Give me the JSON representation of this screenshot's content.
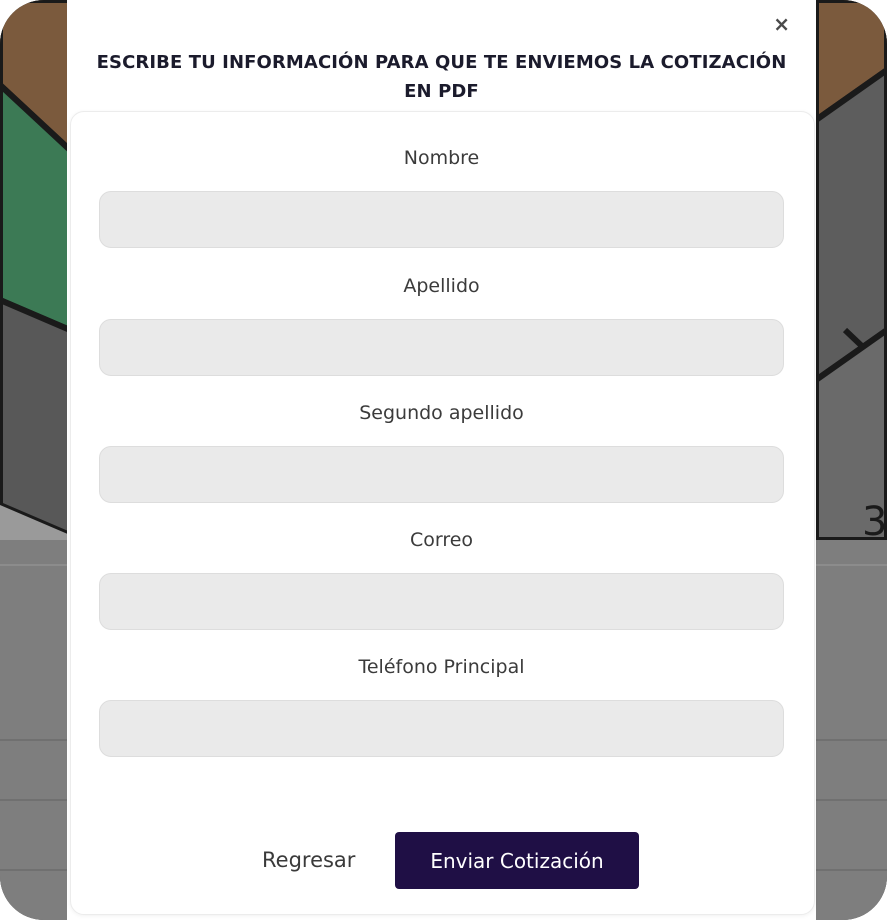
{
  "modal": {
    "close_symbol": "×",
    "title_line1": "ESCRIBE TU INFORMACIÓN PARA QUE TE ENVIEMOS LA COTIZACIÓN",
    "title_line2": "EN PDF"
  },
  "form": {
    "fields": [
      {
        "label": "Nombre",
        "value": "",
        "placeholder": ""
      },
      {
        "label": "Apellido",
        "value": "",
        "placeholder": ""
      },
      {
        "label": "Segundo apellido",
        "value": "",
        "placeholder": ""
      },
      {
        "label": "Correo",
        "value": "",
        "placeholder": ""
      },
      {
        "label": "Teléfono Principal",
        "value": "",
        "placeholder": ""
      }
    ]
  },
  "actions": {
    "back_label": "Regresar",
    "send_label": "Enviar Cotización"
  },
  "background": {
    "number_fragment": "3",
    "colors": {
      "brown": "#7b5a3d",
      "green": "#3c7a55",
      "gray": "#5c5c5c",
      "dark": "#1a1a1a"
    }
  },
  "colors": {
    "accent": "#1f0f45",
    "input_bg": "#eaeaea"
  }
}
